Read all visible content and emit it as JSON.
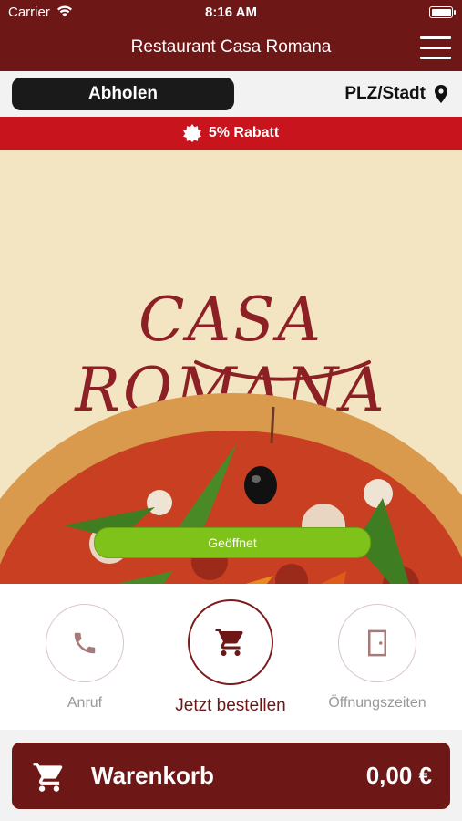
{
  "status_bar": {
    "carrier": "Carrier",
    "time": "8:16 AM"
  },
  "header": {
    "title": "Restaurant Casa Romana"
  },
  "order_mode": {
    "pickup_label": "Abholen",
    "location_label": "PLZ/Stadt"
  },
  "discount": {
    "label": "5% Rabatt"
  },
  "hero": {
    "logo_text": "CASA ROMANA",
    "status_label": "Geöffnet"
  },
  "actions": [
    {
      "label": "Anruf",
      "icon": "phone-icon"
    },
    {
      "label": "Jetzt bestellen",
      "icon": "cart-icon"
    },
    {
      "label": "Öffnungszeiten",
      "icon": "door-icon"
    }
  ],
  "cart": {
    "label": "Warenkorb",
    "total": "0,00 €"
  },
  "colors": {
    "primary": "#6d1717",
    "accent_red": "#c8141c",
    "open_green": "#7ec21a",
    "hero_bg": "#f3e4c2"
  }
}
